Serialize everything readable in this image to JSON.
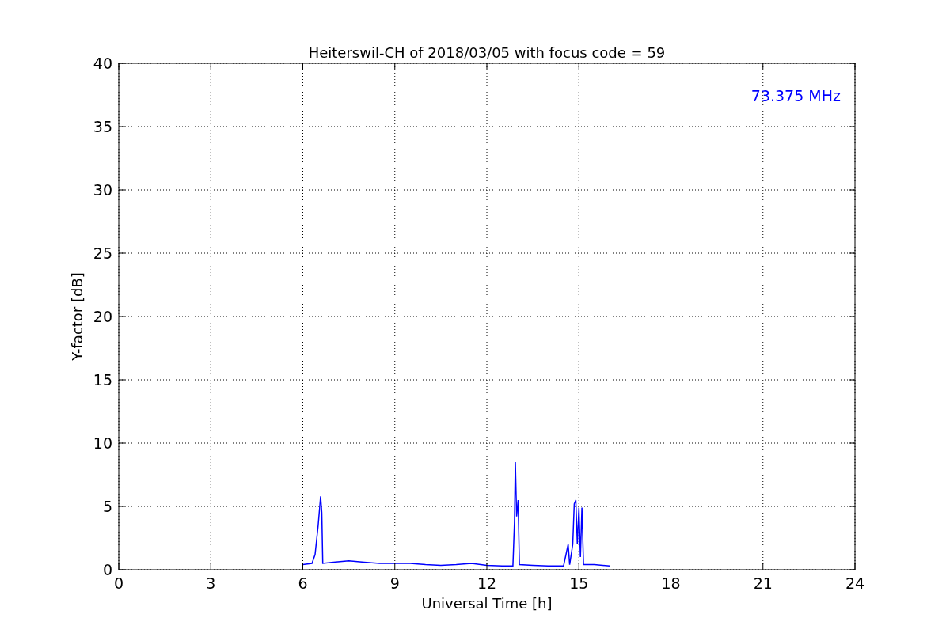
{
  "figure": {
    "chart_data": {
      "type": "line",
      "title": "Heiterswil-CH of 2018/03/05 with focus code = 59",
      "xlabel": "Universal Time [h]",
      "ylabel": "Y-factor [dB]",
      "x": [
        6.0,
        6.3,
        6.4,
        6.5,
        6.58,
        6.62,
        6.65,
        7.0,
        7.5,
        8.0,
        8.5,
        9.0,
        9.5,
        10.0,
        10.5,
        11.0,
        11.5,
        12.0,
        12.5,
        12.85,
        12.9,
        12.93,
        12.97,
        13.02,
        13.06,
        13.5,
        14.0,
        14.5,
        14.65,
        14.7,
        14.8,
        14.85,
        14.9,
        14.95,
        15.0,
        15.05,
        15.1,
        15.15,
        15.5,
        16.0
      ],
      "series": [
        {
          "name": "73.375 MHz",
          "color": "#0000ff",
          "values": [
            0.4,
            0.5,
            1.2,
            3.5,
            5.8,
            4.5,
            0.5,
            0.6,
            0.7,
            0.6,
            0.5,
            0.5,
            0.5,
            0.4,
            0.35,
            0.4,
            0.5,
            0.35,
            0.3,
            0.3,
            3.8,
            8.5,
            4.2,
            5.5,
            0.4,
            0.35,
            0.3,
            0.3,
            2.0,
            0.4,
            2.0,
            5.2,
            5.5,
            2.0,
            4.9,
            1.0,
            4.9,
            0.4,
            0.4,
            0.3
          ]
        }
      ],
      "xlim": [
        0,
        24
      ],
      "ylim": [
        0,
        40
      ],
      "xticks": [
        0,
        3,
        6,
        9,
        12,
        15,
        18,
        21,
        24
      ],
      "yticks": [
        0,
        5,
        10,
        15,
        20,
        25,
        30,
        35,
        40
      ],
      "grid": true
    }
  }
}
